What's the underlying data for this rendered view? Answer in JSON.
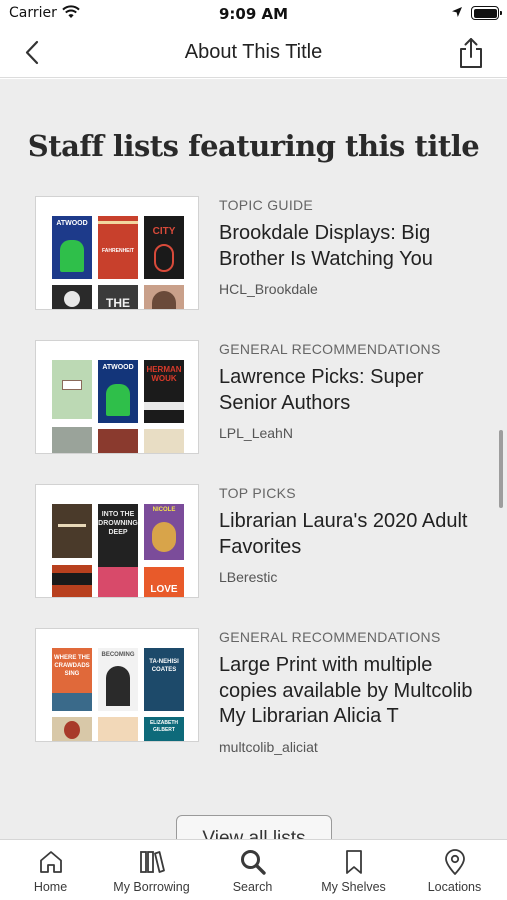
{
  "status_bar": {
    "carrier": "Carrier",
    "time": "9:09 AM"
  },
  "nav": {
    "title": "About This Title"
  },
  "section": {
    "title": "Staff lists featuring this title"
  },
  "lists": [
    {
      "category": "TOPIC GUIDE",
      "title": "Brookdale Displays: Big Brother Is Watching You",
      "owner": "HCL_Brookdale"
    },
    {
      "category": "GENERAL RECOMMENDATIONS",
      "title": "Lawrence Picks: Super Senior Authors",
      "owner": "LPL_LeahN"
    },
    {
      "category": "TOP PICKS",
      "title": "Librarian Laura's 2020 Adult Favorites",
      "owner": "LBerestic"
    },
    {
      "category": "GENERAL RECOMMENDATIONS",
      "title": "Large Print with multiple copies available by Multcolib My Librarian Alicia T",
      "owner": "multcolib_aliciat"
    }
  ],
  "view_all": {
    "label": "View all lists"
  },
  "tabs": [
    {
      "label": "Home",
      "icon": "home-icon"
    },
    {
      "label": "My Borrowing",
      "icon": "books-icon"
    },
    {
      "label": "Search",
      "icon": "search-icon"
    },
    {
      "label": "My Shelves",
      "icon": "bookmark-icon"
    },
    {
      "label": "Locations",
      "icon": "map-pin-icon"
    }
  ],
  "covers": {
    "list1": [
      {
        "text": "ATWOOD",
        "color": "#1d3a8a"
      },
      {
        "text": "FAHRENHEIT",
        "color": "#c8402c"
      },
      {
        "text": "CITY",
        "color": "#1a1a1a"
      },
      {
        "text": "",
        "color": "#2a2a2a"
      },
      {
        "text": "THE",
        "color": "#3b3b3b"
      },
      {
        "text": "",
        "color": "#c9a08a"
      }
    ],
    "list2": [
      {
        "text": "",
        "color": "#bcd9b4"
      },
      {
        "text": "ATWOOD",
        "color": "#13357a"
      },
      {
        "text": "HERMAN WOUK",
        "color": "#1b1b1b"
      },
      {
        "text": "",
        "color": "#9aa39a"
      },
      {
        "text": "",
        "color": "#8a3a2e"
      },
      {
        "text": "",
        "color": "#e8ddc4"
      }
    ],
    "list3": [
      {
        "text": "",
        "color": "#4a3a2a"
      },
      {
        "text": "INTO THE DROWNING DEEP",
        "color": "#222"
      },
      {
        "text": "NICOLE",
        "color": "#7b4c9a"
      },
      {
        "text": "",
        "color": "#b8401e"
      },
      {
        "text": "",
        "color": "#d84a6a"
      },
      {
        "text": "LOVE",
        "color": "#e85a2a"
      }
    ],
    "list4": [
      {
        "text": "WHERE THE CRAWDADS SING",
        "color": "#e0693a"
      },
      {
        "text": "BECOMING",
        "color": "#f2f2f2"
      },
      {
        "text": "TA-NEHISI COATES",
        "color": "#1d4a6a"
      },
      {
        "text": "",
        "color": "#d8c8a8"
      },
      {
        "text": "",
        "color": "#f2d8b8"
      },
      {
        "text": "ELIZABETH GILBERT",
        "color": "#0e6a7a"
      }
    ]
  }
}
